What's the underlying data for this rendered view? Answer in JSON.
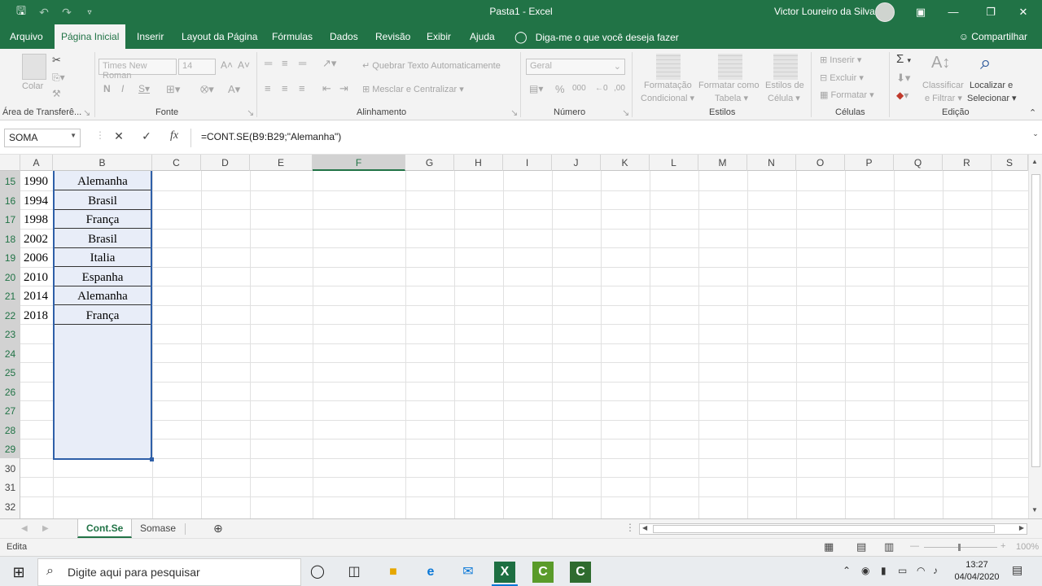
{
  "titlebar": {
    "title": "Pasta1  -  Excel",
    "user": "Victor Loureiro da Silva",
    "colors": {
      "accent": "#217346"
    }
  },
  "tabs": [
    "Arquivo",
    "Página Inicial",
    "Inserir",
    "Layout da Página",
    "Fórmulas",
    "Dados",
    "Revisão",
    "Exibir",
    "Ajuda"
  ],
  "tellme": "Diga-me o que você deseja fazer",
  "share": "Compartilhar",
  "ribbon": {
    "paste": "Colar",
    "font_name": "Times New Roman",
    "font_size": "14",
    "wrap_text": "Quebrar Texto Automaticamente",
    "merge_center": "Mesclar e Centralizar",
    "number_format": "Geral",
    "cond_format_1": "Formatação",
    "cond_format_2": "Condicional",
    "format_table_1": "Formatar como",
    "format_table_2": "Tabela",
    "cell_styles_1": "Estilos de",
    "cell_styles_2": "Célula",
    "insert": "Inserir",
    "delete": "Excluir",
    "format": "Formatar",
    "sort_1": "Classificar",
    "sort_2": "e Filtrar",
    "find_1": "Localizar e",
    "find_2": "Selecionar",
    "groups": {
      "clipboard": "Área de Transferê...",
      "font": "Fonte",
      "alignment": "Alinhamento",
      "number": "Número",
      "styles": "Estilos",
      "cells": "Células",
      "editing": "Edição"
    }
  },
  "formula_bar": {
    "name_box": "SOMA",
    "formula": "=CONT.SE(B9:B29;\"Alemanha\")"
  },
  "columns": [
    "A",
    "B",
    "C",
    "D",
    "E",
    "F",
    "G",
    "H",
    "I",
    "J",
    "K",
    "L",
    "M",
    "N",
    "O",
    "P",
    "Q",
    "R",
    "S"
  ],
  "rows": [
    "15",
    "16",
    "17",
    "18",
    "19",
    "20",
    "21",
    "22",
    "23",
    "24",
    "25",
    "26",
    "27",
    "28",
    "29",
    "30",
    "31",
    "32"
  ],
  "cells": [
    {
      "year": "1990",
      "country": "Alemanha"
    },
    {
      "year": "1994",
      "country": "Brasil"
    },
    {
      "year": "1998",
      "country": "França"
    },
    {
      "year": "2002",
      "country": "Brasil"
    },
    {
      "year": "2006",
      "country": "Italia"
    },
    {
      "year": "2010",
      "country": "Espanha"
    },
    {
      "year": "2014",
      "country": "Alemanha"
    },
    {
      "year": "2018",
      "country": "França"
    }
  ],
  "sheets": [
    "Cont.Se",
    "Somase"
  ],
  "status": {
    "mode": "Edita",
    "zoom": "100%"
  },
  "taskbar": {
    "search_placeholder": "Digite aqui para pesquisar",
    "time": "13:27",
    "date": "04/04/2020"
  }
}
